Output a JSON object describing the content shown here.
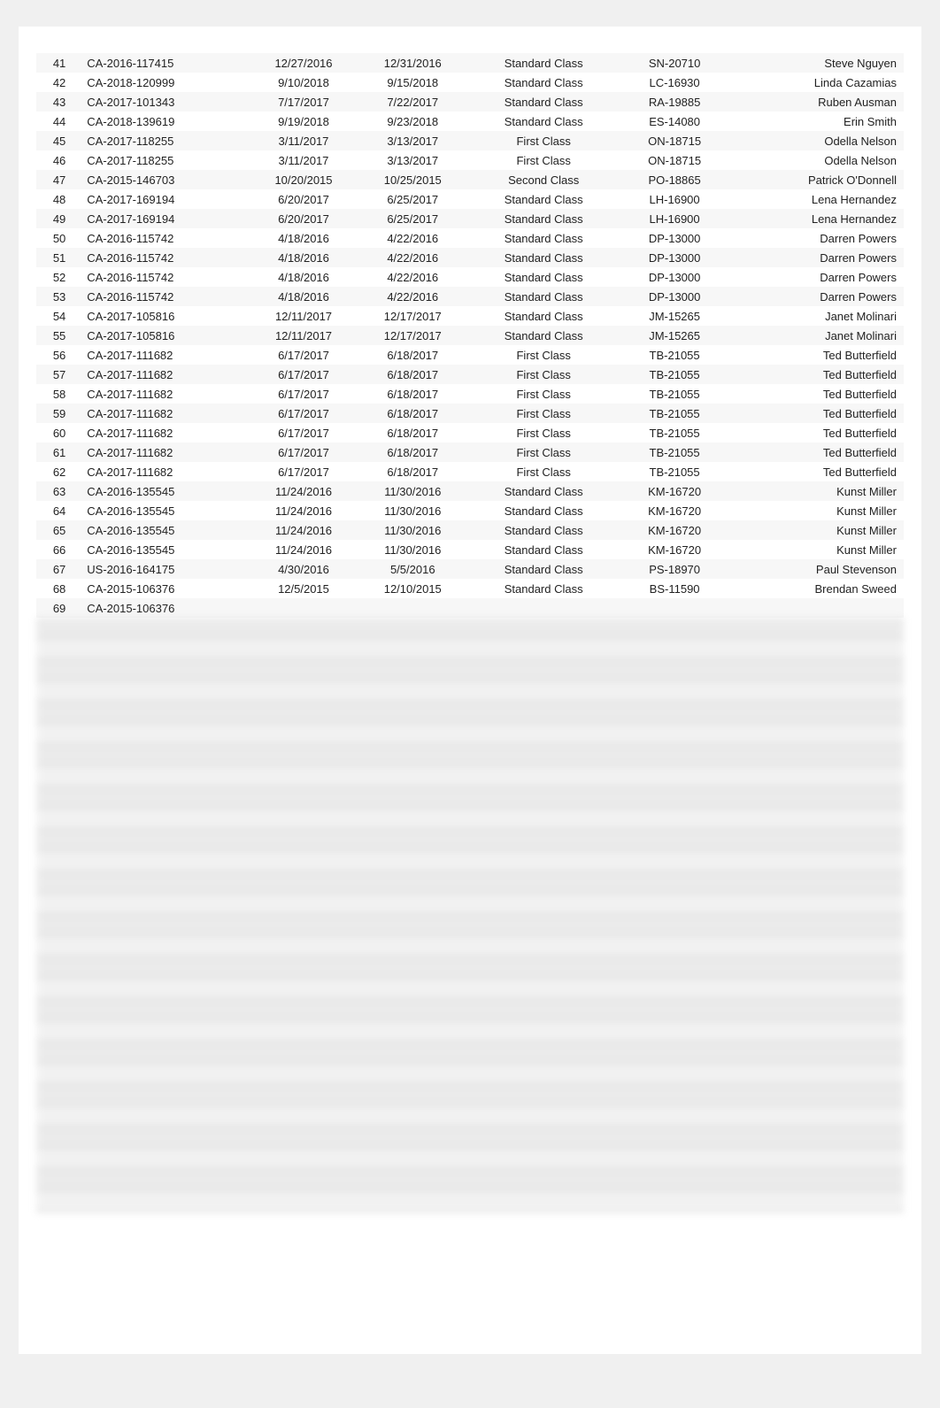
{
  "rows": [
    {
      "num": 41,
      "order_id": "CA-2016-117415",
      "order_date": "12/27/2016",
      "ship_date": "12/31/2016",
      "segment": "Standard Class",
      "customer_id": "SN-20710",
      "customer_name": "Steve Nguyen"
    },
    {
      "num": 42,
      "order_id": "CA-2018-120999",
      "order_date": "9/10/2018",
      "ship_date": "9/15/2018",
      "segment": "Standard Class",
      "customer_id": "LC-16930",
      "customer_name": "Linda Cazamias"
    },
    {
      "num": 43,
      "order_id": "CA-2017-101343",
      "order_date": "7/17/2017",
      "ship_date": "7/22/2017",
      "segment": "Standard Class",
      "customer_id": "RA-19885",
      "customer_name": "Ruben Ausman"
    },
    {
      "num": 44,
      "order_id": "CA-2018-139619",
      "order_date": "9/19/2018",
      "ship_date": "9/23/2018",
      "segment": "Standard Class",
      "customer_id": "ES-14080",
      "customer_name": "Erin Smith"
    },
    {
      "num": 45,
      "order_id": "CA-2017-118255",
      "order_date": "3/11/2017",
      "ship_date": "3/13/2017",
      "segment": "First Class",
      "customer_id": "ON-18715",
      "customer_name": "Odella Nelson"
    },
    {
      "num": 46,
      "order_id": "CA-2017-118255",
      "order_date": "3/11/2017",
      "ship_date": "3/13/2017",
      "segment": "First Class",
      "customer_id": "ON-18715",
      "customer_name": "Odella Nelson"
    },
    {
      "num": 47,
      "order_id": "CA-2015-146703",
      "order_date": "10/20/2015",
      "ship_date": "10/25/2015",
      "segment": "Second Class",
      "customer_id": "PO-18865",
      "customer_name": "Patrick O'Donnell"
    },
    {
      "num": 48,
      "order_id": "CA-2017-169194",
      "order_date": "6/20/2017",
      "ship_date": "6/25/2017",
      "segment": "Standard Class",
      "customer_id": "LH-16900",
      "customer_name": "Lena Hernandez"
    },
    {
      "num": 49,
      "order_id": "CA-2017-169194",
      "order_date": "6/20/2017",
      "ship_date": "6/25/2017",
      "segment": "Standard Class",
      "customer_id": "LH-16900",
      "customer_name": "Lena Hernandez"
    },
    {
      "num": 50,
      "order_id": "CA-2016-115742",
      "order_date": "4/18/2016",
      "ship_date": "4/22/2016",
      "segment": "Standard Class",
      "customer_id": "DP-13000",
      "customer_name": "Darren Powers"
    },
    {
      "num": 51,
      "order_id": "CA-2016-115742",
      "order_date": "4/18/2016",
      "ship_date": "4/22/2016",
      "segment": "Standard Class",
      "customer_id": "DP-13000",
      "customer_name": "Darren Powers"
    },
    {
      "num": 52,
      "order_id": "CA-2016-115742",
      "order_date": "4/18/2016",
      "ship_date": "4/22/2016",
      "segment": "Standard Class",
      "customer_id": "DP-13000",
      "customer_name": "Darren Powers"
    },
    {
      "num": 53,
      "order_id": "CA-2016-115742",
      "order_date": "4/18/2016",
      "ship_date": "4/22/2016",
      "segment": "Standard Class",
      "customer_id": "DP-13000",
      "customer_name": "Darren Powers"
    },
    {
      "num": 54,
      "order_id": "CA-2017-105816",
      "order_date": "12/11/2017",
      "ship_date": "12/17/2017",
      "segment": "Standard Class",
      "customer_id": "JM-15265",
      "customer_name": "Janet Molinari"
    },
    {
      "num": 55,
      "order_id": "CA-2017-105816",
      "order_date": "12/11/2017",
      "ship_date": "12/17/2017",
      "segment": "Standard Class",
      "customer_id": "JM-15265",
      "customer_name": "Janet Molinari"
    },
    {
      "num": 56,
      "order_id": "CA-2017-111682",
      "order_date": "6/17/2017",
      "ship_date": "6/18/2017",
      "segment": "First Class",
      "customer_id": "TB-21055",
      "customer_name": "Ted Butterfield"
    },
    {
      "num": 57,
      "order_id": "CA-2017-111682",
      "order_date": "6/17/2017",
      "ship_date": "6/18/2017",
      "segment": "First Class",
      "customer_id": "TB-21055",
      "customer_name": "Ted Butterfield"
    },
    {
      "num": 58,
      "order_id": "CA-2017-111682",
      "order_date": "6/17/2017",
      "ship_date": "6/18/2017",
      "segment": "First Class",
      "customer_id": "TB-21055",
      "customer_name": "Ted Butterfield"
    },
    {
      "num": 59,
      "order_id": "CA-2017-111682",
      "order_date": "6/17/2017",
      "ship_date": "6/18/2017",
      "segment": "First Class",
      "customer_id": "TB-21055",
      "customer_name": "Ted Butterfield"
    },
    {
      "num": 60,
      "order_id": "CA-2017-111682",
      "order_date": "6/17/2017",
      "ship_date": "6/18/2017",
      "segment": "First Class",
      "customer_id": "TB-21055",
      "customer_name": "Ted Butterfield"
    },
    {
      "num": 61,
      "order_id": "CA-2017-111682",
      "order_date": "6/17/2017",
      "ship_date": "6/18/2017",
      "segment": "First Class",
      "customer_id": "TB-21055",
      "customer_name": "Ted Butterfield"
    },
    {
      "num": 62,
      "order_id": "CA-2017-111682",
      "order_date": "6/17/2017",
      "ship_date": "6/18/2017",
      "segment": "First Class",
      "customer_id": "TB-21055",
      "customer_name": "Ted Butterfield"
    },
    {
      "num": 63,
      "order_id": "CA-2016-135545",
      "order_date": "11/24/2016",
      "ship_date": "11/30/2016",
      "segment": "Standard Class",
      "customer_id": "KM-16720",
      "customer_name": "Kunst Miller"
    },
    {
      "num": 64,
      "order_id": "CA-2016-135545",
      "order_date": "11/24/2016",
      "ship_date": "11/30/2016",
      "segment": "Standard Class",
      "customer_id": "KM-16720",
      "customer_name": "Kunst Miller"
    },
    {
      "num": 65,
      "order_id": "CA-2016-135545",
      "order_date": "11/24/2016",
      "ship_date": "11/30/2016",
      "segment": "Standard Class",
      "customer_id": "KM-16720",
      "customer_name": "Kunst Miller"
    },
    {
      "num": 66,
      "order_id": "CA-2016-135545",
      "order_date": "11/24/2016",
      "ship_date": "11/30/2016",
      "segment": "Standard Class",
      "customer_id": "KM-16720",
      "customer_name": "Kunst Miller"
    },
    {
      "num": 67,
      "order_id": "US-2016-164175",
      "order_date": "4/30/2016",
      "ship_date": "5/5/2016",
      "segment": "Standard Class",
      "customer_id": "PS-18970",
      "customer_name": "Paul Stevenson"
    },
    {
      "num": 68,
      "order_id": "CA-2015-106376",
      "order_date": "12/5/2015",
      "ship_date": "12/10/2015",
      "segment": "Standard Class",
      "customer_id": "BS-11590",
      "customer_name": "Brendan Sweed"
    },
    {
      "num": 69,
      "order_id": "CA-2015-106376",
      "order_date": "",
      "ship_date": "",
      "segment": "",
      "customer_id": "",
      "customer_name": ""
    }
  ]
}
